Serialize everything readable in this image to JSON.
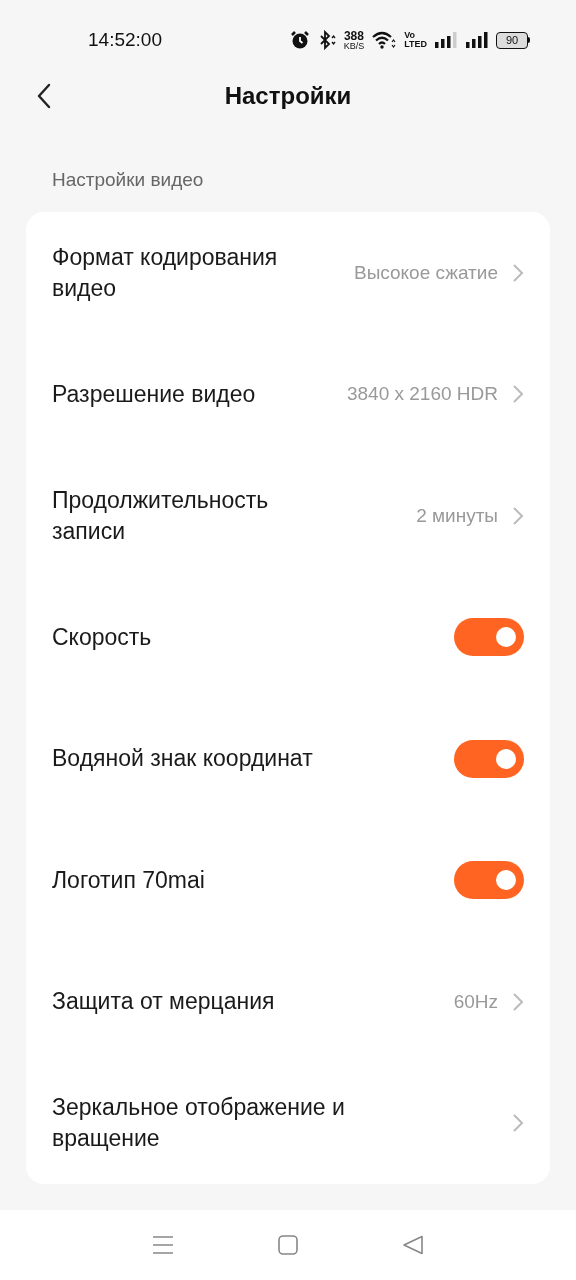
{
  "status_bar": {
    "time": "14:52:00",
    "speed_value": "388",
    "speed_unit": "KB/S",
    "volte_top": "Vo",
    "volte_bottom": "LTED",
    "battery": "90"
  },
  "header": {
    "title": "Настройки"
  },
  "section": {
    "label": "Настройки видео"
  },
  "settings": [
    {
      "kind": "link",
      "label": "Формат кодирования видео",
      "value": "Высокое сжатие"
    },
    {
      "kind": "link",
      "label": "Разрешение видео",
      "value": "3840 x 2160 HDR"
    },
    {
      "kind": "link",
      "label": "Продолжительность записи",
      "value": "2 минуты"
    },
    {
      "kind": "toggle",
      "label": "Скорость",
      "on": true
    },
    {
      "kind": "toggle",
      "label": "Водяной знак координат",
      "on": true
    },
    {
      "kind": "toggle",
      "label": "Логотип 70mai",
      "on": true
    },
    {
      "kind": "link",
      "label": "Защита от мерцания",
      "value": "60Hz"
    },
    {
      "kind": "link",
      "label": "Зеркальное отображение и вращение"
    }
  ]
}
